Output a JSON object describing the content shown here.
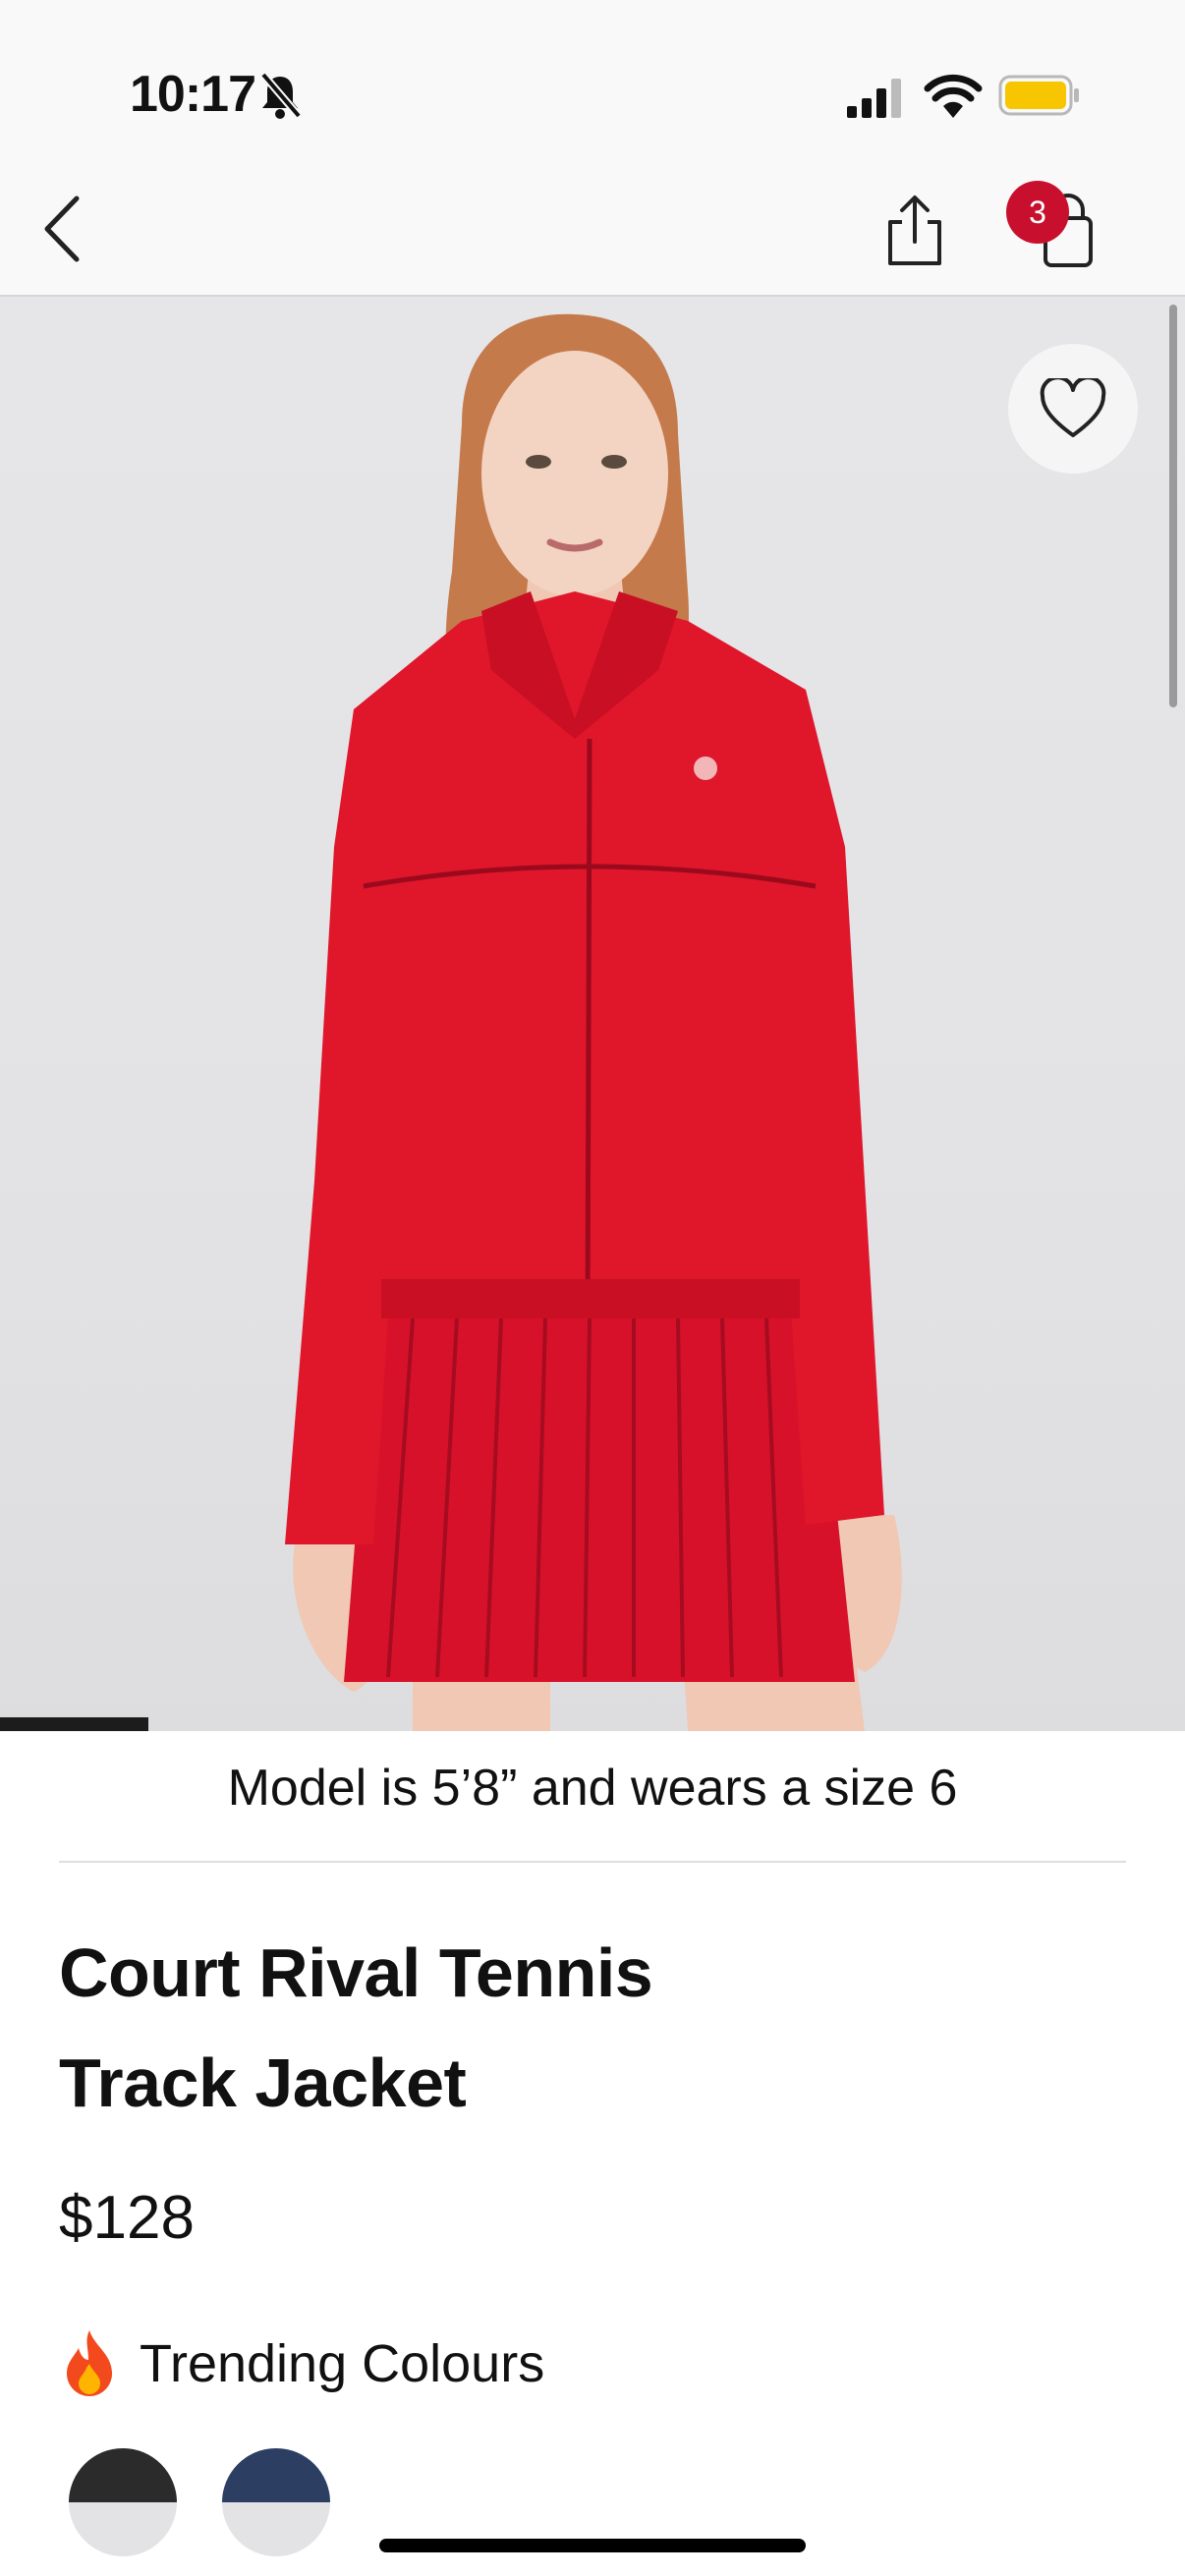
{
  "status_bar": {
    "time": "10:17",
    "battery_color": "#f7c600"
  },
  "header": {
    "cart_count": "3",
    "badge_color": "#c8102e"
  },
  "product": {
    "model_note": "Model is 5’8” and wears a size 6",
    "title_line1": "Court Rival Tennis",
    "title_line2": "Track Jacket",
    "price": "$128",
    "garment_color": "#e0162b"
  },
  "colours": {
    "label": "Trending Colours",
    "swatches": [
      {
        "name": "black",
        "color": "#2b2b2b"
      },
      {
        "name": "navy",
        "color": "#2d3e63"
      }
    ]
  },
  "carousel": {
    "progress_fraction": 0.125
  },
  "icons": [
    "bell-slash-icon",
    "signal-icon",
    "wifi-icon",
    "battery-icon",
    "back-chevron-icon",
    "share-icon",
    "shopping-bag-icon",
    "heart-icon",
    "fire-icon"
  ]
}
